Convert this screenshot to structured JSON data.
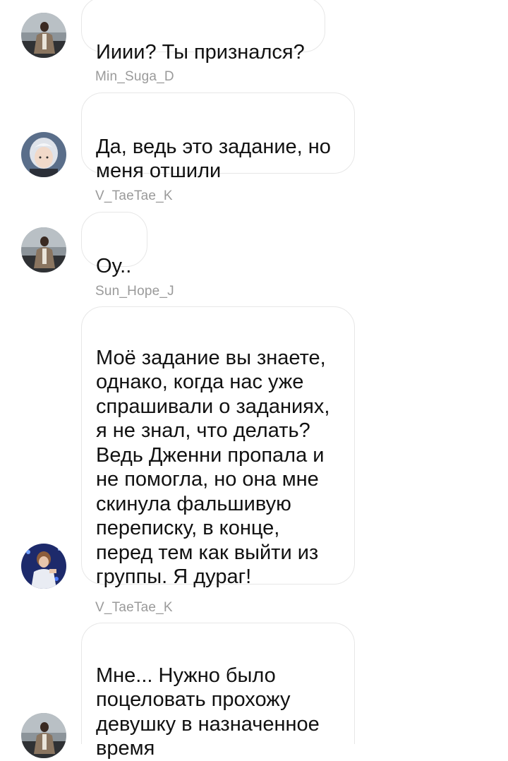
{
  "messages": [
    {
      "sender": "",
      "avatar": "coat-man-avatar",
      "text": "Ииии? Ты признался?"
    },
    {
      "sender": "Min_Suga_D",
      "avatar": "white-hair-avatar",
      "text": "Да, ведь это задание, но\nменя отшили"
    },
    {
      "sender": "V_TaeTae_K",
      "avatar": "coat-man-avatar",
      "text": "Оу.."
    },
    {
      "sender": "Sun_Hope_J",
      "avatar": "stage-performer-avatar",
      "text": "Моё задание вы знаете,\nоднако, когда нас уже\nспрашивали о заданиях,\nя не знал, что делать?\nВедь Дженни пропала и\nне помогла, но она мне\nскинула фальшивую\nпереписку, в конце,\nперед тем как выйти из\nгруппы. Я дураг!"
    },
    {
      "sender": "V_TaeTae_K",
      "avatar": "coat-man-avatar",
      "text": "Мне... Нужно было\nпоцеловать прохожу\nдевушку в назначенное\nвремя"
    }
  ]
}
